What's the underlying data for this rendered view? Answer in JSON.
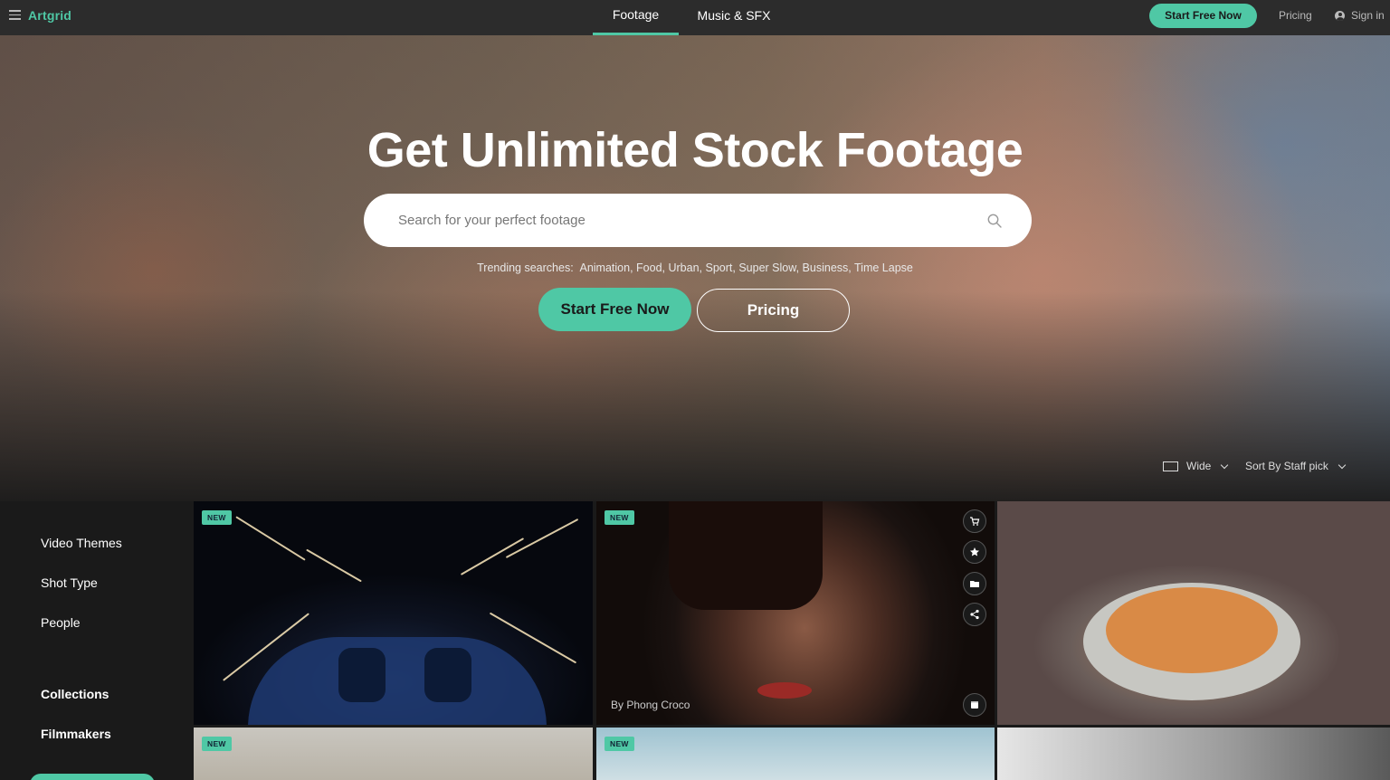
{
  "nav": {
    "logo": "Artgrid",
    "tabs": [
      {
        "label": "Footage",
        "active": true
      },
      {
        "label": "Music & SFX",
        "active": false
      }
    ],
    "cta": "Start Free Now",
    "pricing": "Pricing",
    "signin": "Sign in"
  },
  "hero": {
    "title": "Get Unlimited Stock Footage",
    "search_placeholder": "Search for your perfect footage",
    "trending_label": "Trending searches:",
    "trending": [
      "Animation,",
      "Food,",
      "Urban,",
      "Sport,",
      "Super Slow,",
      "Business,",
      "Time Lapse"
    ],
    "cta": "Start Free Now",
    "pricing": "Pricing"
  },
  "controls": {
    "view": "Wide",
    "sort": "Sort By Staff pick"
  },
  "sidebar": {
    "items": [
      "Video Themes",
      "Shot Type",
      "People"
    ],
    "links": [
      "Collections",
      "Filmmakers"
    ]
  },
  "grid": {
    "badge": "NEW",
    "byline": "By Phong Croco",
    "actions": [
      "cart-icon",
      "star-icon",
      "folder-icon",
      "share-icon",
      "download-icon"
    ]
  },
  "colors": {
    "accent": "#4fc8a5",
    "nav_bg": "#2c2c2c",
    "page_bg": "#1a1a1a"
  }
}
